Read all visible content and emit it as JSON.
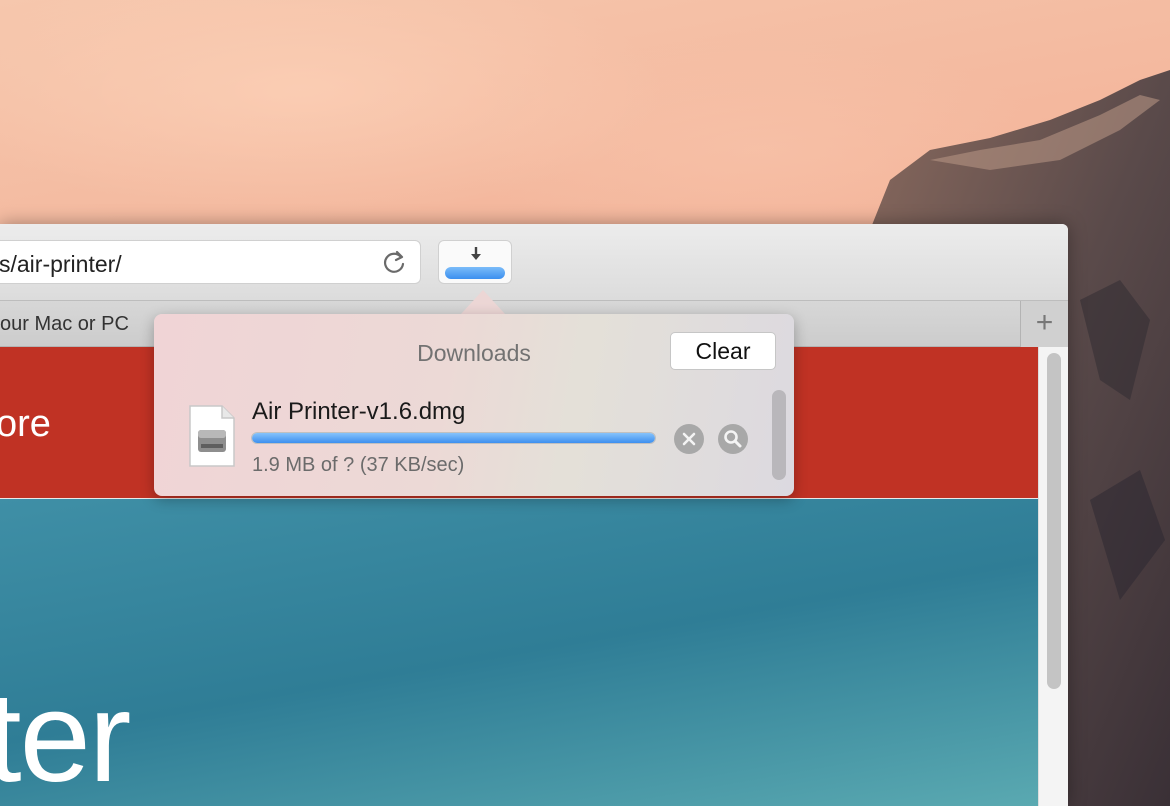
{
  "browser": {
    "url_text": "s/air-printer/",
    "tab_label": "our Mac or PC",
    "new_tab_label": "+"
  },
  "page": {
    "red_band_text": "ore",
    "hero_text": "ter"
  },
  "downloads": {
    "title": "Downloads",
    "clear_label": "Clear",
    "items": [
      {
        "file_name": "Air Printer-v1.6.dmg",
        "status": "1.9 MB of ? (37 KB/sec)",
        "progress": 1.0
      }
    ]
  },
  "colors": {
    "accent_blue": "#3d8fef",
    "page_red": "#c03224",
    "page_teal": "#2f7d96"
  },
  "icons": {
    "reload": "reload-icon",
    "download": "download-arrow-icon",
    "cancel": "close-circle-icon",
    "reveal": "magnifier-icon",
    "file": "dmg-disk-file-icon"
  }
}
